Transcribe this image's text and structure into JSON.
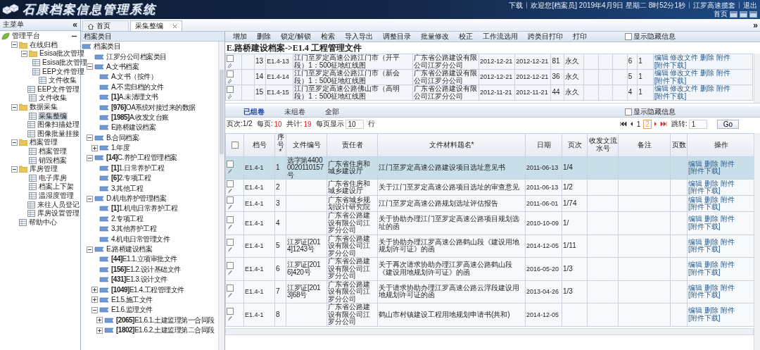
{
  "header": {
    "title": "石康档案信息管理系统",
    "links": [
      {
        "text": "下载"
      },
      {
        "text": "欢迎您[档案员] 2019年4月9日 星期二 8时52分1秒"
      },
      {
        "text": "江罗高速揽套"
      },
      {
        "text": "退出"
      }
    ],
    "home": "首页"
  },
  "sidebar": {
    "title": "主菜单",
    "collapse": "«",
    "items": [
      {
        "label": "管理平台",
        "kind": "platform",
        "expanded": true,
        "children": [
          {
            "label": "在线归档",
            "kind": "folder",
            "expanded": true,
            "children": [
              {
                "label": "Esisa批次管理",
                "kind": "folder",
                "expanded": true,
                "children": [
                  {
                    "label": "Esisa批次管理",
                    "kind": "page",
                    "selected": false
                  },
                  {
                    "label": "EEP文件管理",
                    "kind": "page",
                    "selected": false
                  },
                  {
                    "label": "文件收集",
                    "kind": "page",
                    "selected": false
                  }
                ]
              },
              {
                "label": "EEP文件管理",
                "kind": "page",
                "selected": false
              },
              {
                "label": "文件收集",
                "kind": "page",
                "selected": false
              }
            ]
          },
          {
            "label": "数据采集",
            "kind": "folder",
            "expanded": true,
            "children": [
              {
                "label": "采集整编",
                "kind": "page",
                "selected": true
              },
              {
                "label": "图像扫描处理",
                "kind": "page",
                "selected": false
              },
              {
                "label": "图像批量挂接",
                "kind": "page",
                "selected": false
              }
            ]
          },
          {
            "label": "档案管理",
            "kind": "folder",
            "expanded": true,
            "children": [
              {
                "label": "档案管理",
                "kind": "page",
                "selected": false
              },
              {
                "label": "销毁档案",
                "kind": "page",
                "selected": false
              }
            ]
          },
          {
            "label": "库房管理",
            "kind": "folder",
            "expanded": true,
            "children": [
              {
                "label": "电子库房",
                "kind": "page",
                "selected": false
              },
              {
                "label": "档案上下架",
                "kind": "page",
                "selected": false
              },
              {
                "label": "温湿度管理",
                "kind": "page",
                "selected": false
              },
              {
                "label": "来往人员登记",
                "kind": "page",
                "selected": false
              },
              {
                "label": "库房设置管理",
                "kind": "page",
                "selected": false
              }
            ]
          },
          {
            "label": "帮助中心",
            "kind": "page",
            "selected": false
          }
        ]
      }
    ]
  },
  "tabs": [
    {
      "label": "首页",
      "kind": "home",
      "selected": false
    },
    {
      "label": "采集整编",
      "kind": "closable",
      "selected": true
    }
  ],
  "expand_panel": "»",
  "category_tree": {
    "title": "档案类目",
    "items": [
      {
        "label": "档案类目",
        "children": [
          {
            "label": "江罗分公司档案类目"
          },
          {
            "label": "A.文书档案",
            "expanded": true,
            "children": [
              {
                "label": "A.文书（按件）"
              },
              {
                "label": "A.不需归档的文件"
              },
              {
                "label": "**[1]**A.未清理文书"
              },
              {
                "label": "**[976]**OA系统对接过来的数据"
              },
              {
                "label": "**[1985]**A.收发文台账"
              },
              {
                "label": "E路桥建设档案"
              }
            ]
          },
          {
            "label": "B.合同档案",
            "expanded": true,
            "children": [
              {
                "label": "1.年度",
                "expanded": false
              }
            ]
          },
          {
            "label": "**[14]**C.养护工程管理档案",
            "expanded": true,
            "children": [
              {
                "label": "**[1]**1.日常养护工程"
              },
              {
                "label": "**[6]**2.专项工程"
              },
              {
                "label": "3.其他工程"
              }
            ]
          },
          {
            "label": "D.机电养护管理档案",
            "expanded": true,
            "children": [
              {
                "label": "**[1]**1.机电日常养护工程"
              },
              {
                "label": "2.专项工程"
              },
              {
                "label": "3.其他养护工程"
              },
              {
                "label": "4.机电日常管理文件"
              }
            ]
          },
          {
            "label": "E.路桥建设档案",
            "expanded": true,
            "children": [
              {
                "label": "**[44]**E1.1.立项审批文件"
              },
              {
                "label": "**[156]**E1.2.设计基础文件"
              },
              {
                "label": "**[431]**E1.3.设计文件"
              },
              {
                "label": "**[1049]**E1.4.工程管理文件",
                "expanded": false
              },
              {
                "label": "E1.5.施工文件",
                "expanded": false
              },
              {
                "label": "E1.6.监理文件",
                "expanded": true,
                "children": [
                  {
                    "label": "**[2065]**E1.6.1.土建监理第一合同段",
                    "expanded": false
                  },
                  {
                    "label": "**[1802]**E1.6.2.土建监理第二合同段",
                    "expanded": false
                  }
                ]
              }
            ]
          }
        ]
      }
    ]
  },
  "toolbar": {
    "buttons": [
      "增加",
      "删除",
      "锁定/解锁",
      "检索",
      "导入导出",
      "调整目录",
      "批量修改",
      "校正",
      "工作流选用",
      "跨类目打印",
      "打印"
    ],
    "show_hidden": {
      "label": "显示隐藏信息",
      "checked": false
    }
  },
  "breadcrumb": "E.路桥建设档案->E1.4 工程管理文件",
  "upper_table": {
    "rows": [
      {
        "checked": false,
        "seq": "13",
        "code": "E1.4-13",
        "title": "江门至罗定高速公路江门市（开平段）1：500征地红线图",
        "org": "广东省公路建设有限公司江罗分公司",
        "date_1": "2012-12-21",
        "date_2": "2012-12-21",
        "column_9": "81",
        "retention": "永久",
        "column_14": "6",
        "column_15": "1",
        "actions": [
          "编辑",
          "修改文件",
          "删除",
          "附件",
          "[附件下载]"
        ]
      },
      {
        "checked": false,
        "seq": "14",
        "code": "E1.4-14",
        "title": "江门至罗定高速公路江门市（新会段）1：500征地红线图",
        "org": "广东省公路建设有限公司江罗分公司",
        "date_1": "2012-12-21",
        "date_2": "2012-12-21",
        "column_9": "36",
        "retention": "永久",
        "column_14": "5",
        "column_15": "1",
        "actions": [
          "编辑",
          "修改文件",
          "删除",
          "附件",
          "[附件下载]"
        ]
      },
      {
        "checked": false,
        "seq": "15",
        "code": "E1.4-15",
        "title": "江门至罗定高速公路佛山市（高明段）1：500征地红线图",
        "org": "广东省公路建设有限公司江罗分公司",
        "date_1": "2012-11-21",
        "date_2": "2012-11-21",
        "column_9": "44",
        "retention": "永久",
        "column_14": "4",
        "column_15": "1",
        "actions": [
          "编辑",
          "修改文件",
          "删除",
          "附件",
          "[附件下载]"
        ]
      }
    ]
  },
  "view_tabs": [
    {
      "label": "已组卷",
      "selected": true
    },
    {
      "label": "未组卷",
      "selected": false
    },
    {
      "label": "全部",
      "selected": false
    }
  ],
  "view_show_hidden": {
    "label": "显示隐藏信息",
    "checked": false
  },
  "pager": {
    "page_info": "页次:1/2",
    "per_page_label": "每页:",
    "per_page": "10",
    "total_label": "共计:",
    "total": "19",
    "show_label": "每页显示",
    "show_value": "10",
    "show_unit": "行",
    "pages": [
      {
        "label": "1",
        "kind": "plain"
      },
      {
        "label": "2",
        "kind": "boxed"
      }
    ],
    "jump_label": "跳转:",
    "jump_value": "1",
    "go": "Go"
  },
  "table": {
    "select_all": {
      "checked": false
    },
    "columns": [
      "档号",
      "序号*",
      "文件编号",
      "责任者",
      "文件材料题名*",
      "日期",
      "页次",
      "收发文流水号",
      "备注",
      "页数",
      "操作"
    ],
    "rows": [
      {
        "selected": true,
        "checked": false,
        "archive_no": "E1.4-1",
        "seq": "1",
        "doc_no": "选字第44000020110157号",
        "responsible": "广东省住房和城乡建设厅",
        "title": "江门至罗定高速公路建设项目选址意见书",
        "date": "2011-06-13",
        "pages": "1/4",
        "actions": [
          "编辑",
          "删除",
          "附件",
          "[附件下载]"
        ]
      },
      {
        "selected": false,
        "checked": false,
        "archive_no": "E1.4-1",
        "seq": "2",
        "responsible": "广东省住房和城乡建设厅",
        "title": "关于江门至罗定高速公路项目选址的审查意见",
        "date": "2011-06-13",
        "pages": "1/2",
        "actions": [
          "编辑",
          "删除",
          "附件",
          "[附件下载]"
        ]
      },
      {
        "selected": false,
        "checked": false,
        "archive_no": "E1.4-1",
        "seq": "3",
        "responsible": "广东省城乡规划设计研究院",
        "title": "江门至罗定高速公路规划选址评估报告",
        "date": "2011-06-01",
        "pages": "1/74",
        "actions": [
          "编辑",
          "删除",
          "附件",
          "[附件下载]"
        ]
      },
      {
        "selected": false,
        "checked": false,
        "archive_no": "E1.4-1",
        "seq": "4",
        "responsible": "广东省公路建设有限公司江罗分公司",
        "title": "关于协助办理江门至罗定高速公路项目规划选址的函",
        "date": "2010-10-09",
        "pages": "1/",
        "actions": [
          "编辑",
          "删除",
          "附件",
          "[附件下载]"
        ]
      },
      {
        "selected": false,
        "checked": false,
        "archive_no": "E1.4-1",
        "seq": "5",
        "doc_no": "江罗证[2014]1243号",
        "responsible": "广东省公路建设有限公司江罗分公司",
        "title": "关于协助办理江罗高速公路鹤山段《建设用地规划许可证》的函",
        "date": "2014-12-05",
        "pages": "1/11",
        "actions": [
          "编辑",
          "删除",
          "附件",
          "[附件下载]"
        ]
      },
      {
        "selected": false,
        "checked": false,
        "archive_no": "E1.4-1",
        "seq": "6",
        "doc_no": "江罗证[2016]420号",
        "responsible": "广东省公路建设有限公司江罗分公司",
        "title": "关于再次请求协助办理江罗高速公路鹤山段《建设用地规划许可证》的函",
        "date": "2016-05-20",
        "pages": "1/3",
        "actions": [
          "编辑",
          "删除",
          "附件",
          "[附件下载]"
        ]
      },
      {
        "selected": false,
        "checked": false,
        "archive_no": "E1.4-1",
        "seq": "7",
        "doc_no": "江罗证[2013]68号",
        "responsible": "广东省公路建设有限公司江罗分公司",
        "title": "关于请求协助办理江罗高速公路云浮段建设用地规划许可证的函",
        "date": "2013-04-26",
        "pages": "1/3",
        "actions": [
          "编辑",
          "删除",
          "附件",
          "[附件下载]"
        ]
      },
      {
        "selected": false,
        "checked": false,
        "archive_no": "E1.4-1",
        "seq": "8",
        "responsible": "广东省公路建设有限公司江罗分公司",
        "title": "鹤山市村镇建设工程用地规划申请书(共和)",
        "date": "2014-12-05",
        "actions": [
          "编辑",
          "删除",
          "附件",
          "[附件下载]"
        ]
      }
    ]
  }
}
